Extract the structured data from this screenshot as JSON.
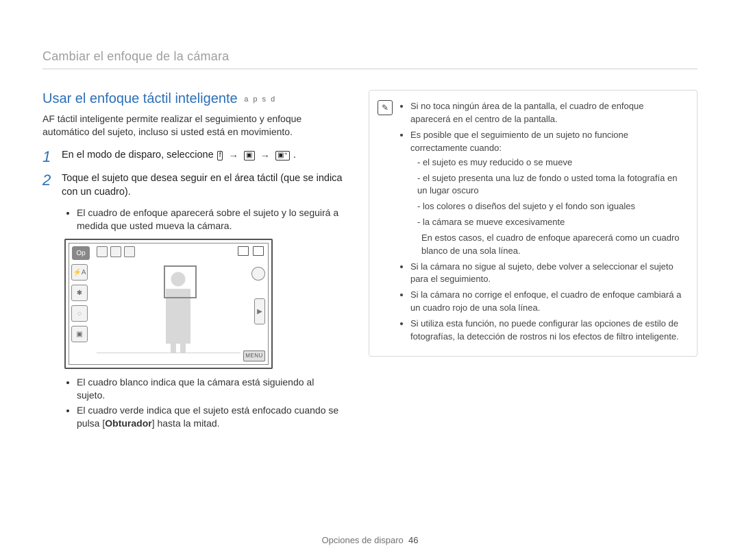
{
  "header": {
    "breadcrumb": "Cambiar el enfoque de la cámara"
  },
  "section": {
    "title": "Usar el enfoque táctil inteligente",
    "modes": "a p s d",
    "intro": "AF táctil inteligente permite realizar el seguimiento y enfoque automático del sujeto, incluso si usted está en movimiento."
  },
  "steps": [
    {
      "num": "1",
      "text_before": "En el modo de disparo, seleccione",
      "icon_f_name": "f",
      "arrow": "→",
      "icon_focus_name": "focus-icon",
      "icon_smart_touch_name": "smart-touch-af-icon",
      "period": "."
    },
    {
      "num": "2",
      "text": "Toque el sujeto que desea seguir en el área táctil (que se indica con un cuadro).",
      "bullets": [
        "El cuadro de enfoque aparecerá sobre el sujeto y lo seguirá a medida que usted mueva la cámara."
      ],
      "bullets_after": [
        "El cuadro blanco indica que la cámara está siguiendo al sujeto.",
        {
          "pre": "El cuadro verde indica que el sujeto está enfocado cuando se pulsa [",
          "bold": "Obturador",
          "post": "] hasta la mitad."
        }
      ]
    }
  ],
  "lcd": {
    "mode_label": "Op",
    "menu_label": "MENU",
    "left_icons": [
      "flash-auto-icon",
      "self-timer-icon",
      "focus-mode-icon",
      "drive-mode-icon"
    ]
  },
  "info": {
    "items": [
      "Si no toca ningún área de la pantalla, el cuadro de enfoque aparecerá en el centro de la pantalla.",
      "Es posible que el seguimiento de un sujeto no funcione correctamente cuando:"
    ],
    "sub_items": [
      "el sujeto es muy reducido o se mueve",
      "el sujeto presenta una luz de fondo o usted toma la fotografía en un lugar oscuro",
      "los colores o diseños del sujeto y el fondo son iguales",
      "la cámara se mueve excesivamente"
    ],
    "note_after_sub": "En estos casos, el cuadro de enfoque aparecerá como un cuadro blanco de una sola línea.",
    "items_tail": [
      "Si la cámara no sigue al sujeto, debe volver a seleccionar el sujeto para el seguimiento.",
      "Si la cámara no corrige el enfoque, el cuadro de enfoque cambiará a un cuadro rojo de una sola línea.",
      "Si utiliza esta función, no puede configurar las opciones de estilo de fotografías, la detección de rostros ni los efectos de filtro inteligente."
    ]
  },
  "footer": {
    "section": "Opciones de disparo",
    "page": "46"
  }
}
